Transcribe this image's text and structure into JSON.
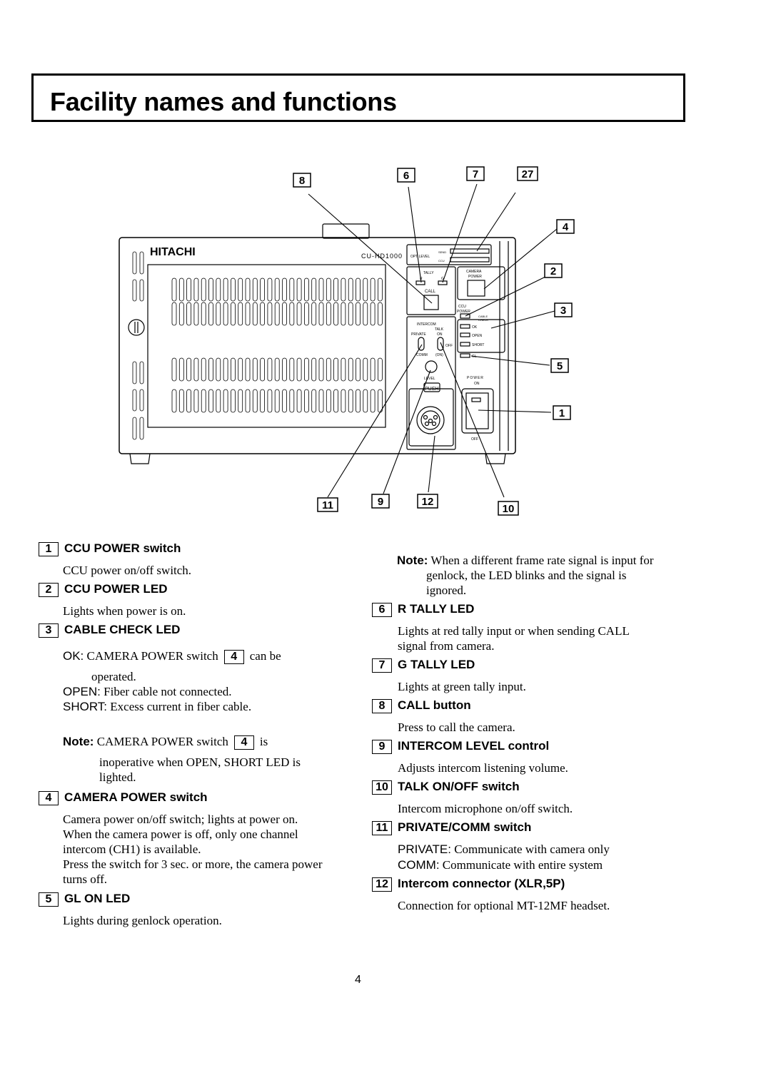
{
  "title": "Facility names and functions",
  "diagram": {
    "brand": "HITACHI",
    "model": "CU-HD1000",
    "panel_labels": {
      "opt_level": "OPT LEVEL",
      "send": "SEND",
      "ccu": "CCU",
      "tally": "TALLY",
      "r": "R",
      "g": "G",
      "call": "CALL",
      "camera": "CAMERA",
      "power": "POWER",
      "ccu_power_1": "CCU",
      "ccu_power_2": "POWER",
      "cable_check_1": "CABLE",
      "cable_check_2": "CHECK",
      "ok": "OK",
      "open": "OPEN",
      "short": "SHORT",
      "gl": "GL",
      "intercom": "INTERCOM",
      "talk": "TALK",
      "private": "PRIVATE",
      "on": "ON",
      "off": "OFF",
      "comm": "COMM",
      "on2": "(ON)",
      "level": "LEVEL",
      "push": "PUSH",
      "power_main": "POWER",
      "power_on": "ON",
      "power_off": "OFF"
    },
    "callouts": [
      "8",
      "6",
      "7",
      "27",
      "4",
      "2",
      "3",
      "5",
      "1",
      "11",
      "9",
      "12",
      "10"
    ]
  },
  "left_column": [
    {
      "num": "1",
      "label": "CCU POWER switch",
      "body": [
        "CCU power on/off switch."
      ]
    },
    {
      "num": "2",
      "label": "CCU POWER LED",
      "body": [
        "Lights when power is on."
      ]
    },
    {
      "num": "3",
      "label": "CABLE CHECK LED",
      "ok_key": "OK:",
      "ok_text": "CAMERA POWER switch",
      "ok_ref": "4",
      "ok_tail": "can be",
      "ok_cont": "operated.",
      "open_key": "OPEN:",
      "open_text": "Fiber cable not connected.",
      "short_key": "SHORT:",
      "short_text": "Excess current in fiber cable.",
      "note_key": "Note:",
      "note_text": "CAMERA POWER switch",
      "note_ref": "4",
      "note_tail": "is",
      "note_cont": [
        "inoperative when OPEN, SHORT LED is",
        "lighted."
      ]
    },
    {
      "num": "4",
      "label": "CAMERA POWER switch",
      "body": [
        "Camera power on/off switch; lights at power on.",
        "When the camera power is off, only one channel",
        "intercom (CH1) is available.",
        "Press the switch for 3 sec. or more, the camera power",
        "turns off."
      ]
    },
    {
      "num": "5",
      "label": "GL ON LED",
      "body": [
        "Lights during genlock operation."
      ]
    }
  ],
  "right_note": {
    "key": "Note:",
    "lines": [
      "When a different frame rate signal is input for",
      "genlock, the LED blinks and the signal is",
      "ignored."
    ]
  },
  "right_column": [
    {
      "num": "6",
      "label": "R TALLY LED",
      "body": [
        "Lights at red tally input or when sending CALL",
        "signal from camera."
      ]
    },
    {
      "num": "7",
      "label": "G TALLY LED",
      "body": [
        "Lights at green tally input."
      ]
    },
    {
      "num": "8",
      "label": "CALL button",
      "body": [
        "Press to call the camera."
      ]
    },
    {
      "num": "9",
      "label": "INTERCOM LEVEL control",
      "body": [
        "Adjusts intercom listening volume."
      ]
    },
    {
      "num": "10",
      "label": "TALK ON/OFF switch",
      "body": [
        "Intercom microphone on/off switch."
      ]
    },
    {
      "num": "11",
      "label": "PRIVATE/COMM switch",
      "private_key": "PRIVATE:",
      "private_text": "Communicate with camera only",
      "comm_key": "COMM:",
      "comm_text": "Communicate with entire system"
    },
    {
      "num": "12",
      "label": "Intercom connector (XLR,5P)",
      "body": [
        "Connection for optional MT-12MF headset."
      ]
    }
  ],
  "page_number": "4"
}
